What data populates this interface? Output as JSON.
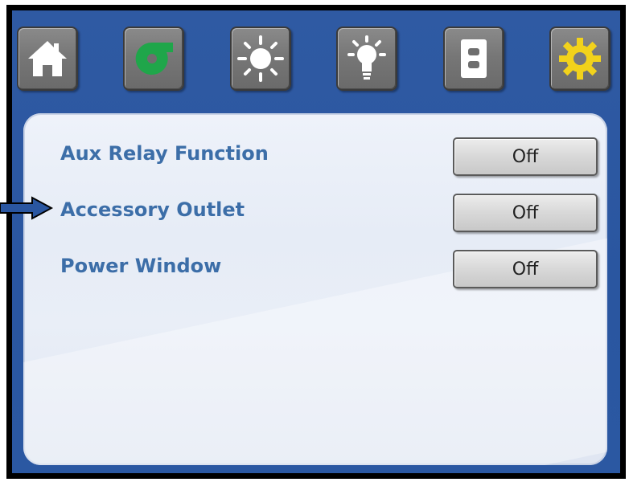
{
  "toolbar": {
    "buttons": [
      {
        "name": "home",
        "icon": "house-icon",
        "icon_color": "#ffffff"
      },
      {
        "name": "blower",
        "icon": "blower-fan-icon",
        "icon_color": "#1fa64a"
      },
      {
        "name": "exterior-light",
        "icon": "sun-icon",
        "icon_color": "#ffffff"
      },
      {
        "name": "interior-light",
        "icon": "light-bulb-icon",
        "icon_color": "#ffffff"
      },
      {
        "name": "outlet",
        "icon": "outlet-icon",
        "icon_color": "#ffffff"
      },
      {
        "name": "settings",
        "icon": "gear-icon",
        "icon_color": "#f2d21b"
      }
    ]
  },
  "settings": {
    "rows": [
      {
        "label": "Aux Relay Function",
        "value": "Off"
      },
      {
        "label": "Accessory Outlet",
        "value": "Off"
      },
      {
        "label": "Power Window",
        "value": "Off"
      }
    ],
    "selected_row": "Accessory Outlet"
  },
  "colors": {
    "frame": "#000000",
    "background": "#2f5aa3",
    "label": "#3c6ea8",
    "panel": "#e8edf6"
  }
}
